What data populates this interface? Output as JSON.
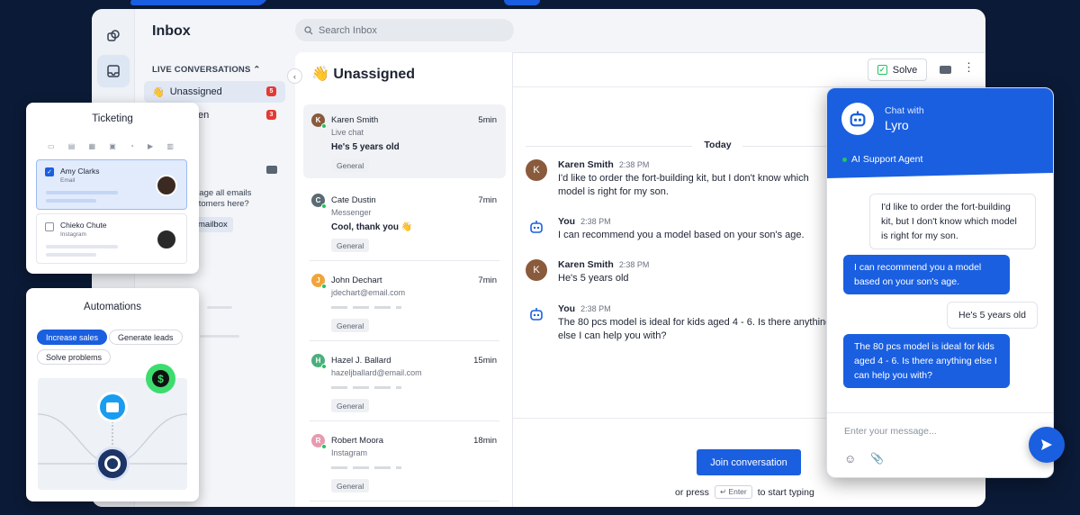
{
  "rail": {
    "icons": [
      "shapes-icon",
      "inbox-icon"
    ]
  },
  "inbox": {
    "title": "Inbox",
    "search_placeholder": "Search Inbox",
    "section_label": "LIVE CONVERSATIONS",
    "nav": [
      {
        "emoji": "👋",
        "label": "Unassigned",
        "count": "5"
      },
      {
        "emoji": "",
        "label": "en",
        "count": "3"
      }
    ],
    "info_text_1": "nage all emails",
    "info_text_2": "stomers here?",
    "mailbox_label": "mailbox"
  },
  "list": {
    "title": "👋 Unassigned",
    "items": [
      {
        "initial": "K",
        "color": "#8a5a3c",
        "name": "Karen Smith",
        "time": "5min",
        "channel": "Live chat",
        "message": "He's 5 years old",
        "tag": "General"
      },
      {
        "initial": "C",
        "color": "#5b6b73",
        "name": "Cate Dustin",
        "time": "7min",
        "channel": "Messenger",
        "message": "Cool, thank you 👋",
        "tag": "General"
      },
      {
        "initial": "J",
        "color": "#f0a43a",
        "name": "John Dechart",
        "time": "7min",
        "channel": "jdechart@email.com",
        "message": "",
        "tag": "General"
      },
      {
        "initial": "H",
        "color": "#4caf7d",
        "name": "Hazel J. Ballard",
        "time": "15min",
        "channel": "hazeljballard@email.com",
        "message": "",
        "tag": "General"
      },
      {
        "initial": "R",
        "color": "#e69ab0",
        "name": "Robert Moora",
        "time": "18min",
        "channel": "Instagram",
        "message": "",
        "tag": "General"
      }
    ]
  },
  "chat": {
    "solve_label": "Solve",
    "date_label": "Today",
    "messages": [
      {
        "sender": "Karen Smith",
        "time": "2:38 PM",
        "text": "I'd like to order the fort-building kit, but I don't know which model is right for my son.",
        "avatar": "K"
      },
      {
        "sender": "You",
        "time": "2:38 PM",
        "text": "I can recommend you a model based on your son's age.",
        "avatar": "bot"
      },
      {
        "sender": "Karen Smith",
        "time": "2:38 PM",
        "text": "He's 5 years old",
        "avatar": "K"
      },
      {
        "sender": "You",
        "time": "2:38 PM",
        "text": "The 80 pcs model is ideal for kids aged 4 - 6. Is there anything else I can help you with?",
        "avatar": "bot"
      }
    ],
    "join_label": "Join conversation",
    "hint_prefix": "or press",
    "hint_key": "↵ Enter",
    "hint_suffix": "to start typing"
  },
  "widget": {
    "chat_with": "Chat with",
    "bot_name": "Lyro",
    "status": "AI Support Agent",
    "bubbles": [
      {
        "side": "in",
        "text": "I'd like to order the fort-building kit, but I don't know which model is right for my son."
      },
      {
        "side": "out",
        "text": "I can recommend you a model based on your son's age."
      },
      {
        "side": "in",
        "text": "He's 5 years old"
      },
      {
        "side": "out",
        "text": "The 80 pcs model is ideal for kids aged 4 - 6. Is there anything else I can help you with?"
      }
    ],
    "input_placeholder": "Enter your message..."
  },
  "ticketing": {
    "title": "Ticketing",
    "rows": [
      {
        "name": "Amy Clarks",
        "sub": "Email",
        "checked": true
      },
      {
        "name": "Chieko Chute",
        "sub": "Instagram",
        "checked": false
      }
    ]
  },
  "automations": {
    "title": "Automations",
    "pills": [
      "Increase sales",
      "Generate leads",
      "Solve problems"
    ],
    "dollar": "$"
  },
  "colors": {
    "accent": "#1a5fe0",
    "success": "#22c55e",
    "danger": "#e53935"
  }
}
